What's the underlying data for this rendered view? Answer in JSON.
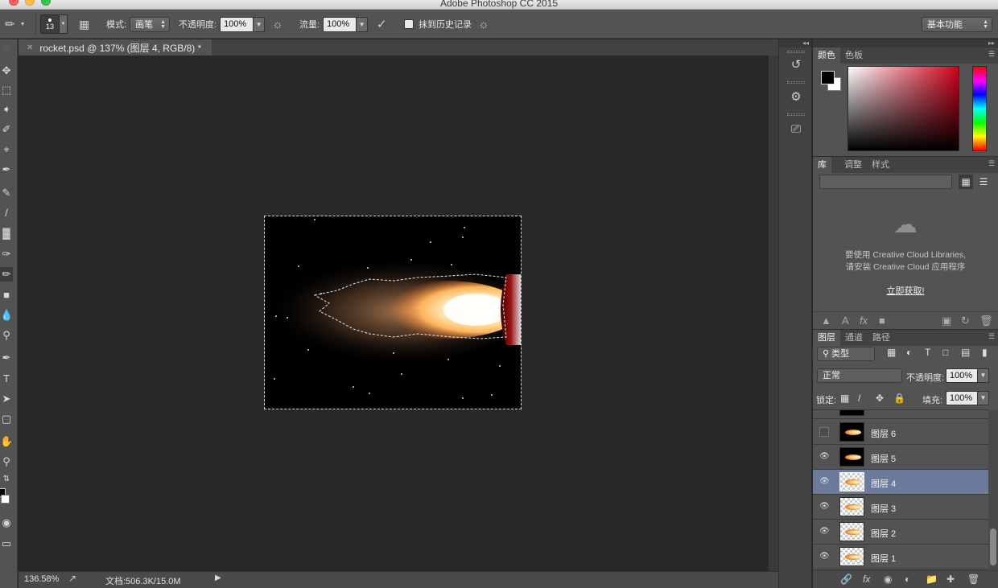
{
  "app": {
    "title": "Adobe Photoshop CC 2015"
  },
  "options": {
    "brush_size": "13",
    "mode_label": "模式:",
    "mode_value": "画笔",
    "opacity_label": "不透明度:",
    "opacity_value": "100%",
    "flow_label": "流量:",
    "flow_value": "100%",
    "history_label": "抹到历史记录",
    "workspace_value": "基本功能"
  },
  "document": {
    "tab_label": "rocket.psd @ 137% (图层 4, RGB/8) *",
    "zoom": "136.58%",
    "doc_info": "文档:506.3K/15.0M"
  },
  "panels": {
    "color_tabs": [
      "颜色",
      "色板"
    ],
    "library_tabs": [
      "库",
      "调整",
      "样式"
    ],
    "library_msg_line1": "要使用 Creative Cloud Libraries,",
    "library_msg_line2": "请安装 Creative Cloud 应用程序",
    "library_link": "立即获取!",
    "layer_tabs": [
      "图层",
      "通道",
      "路径"
    ],
    "filter_kind": "类型",
    "blend_mode": "正常",
    "opacity_label": "不透明度:",
    "opacity_value": "100%",
    "lock_label": "锁定:",
    "fill_label": "填充:",
    "fill_value": "100%"
  },
  "layers": [
    {
      "name": "图层 6",
      "visible": false,
      "selected": false,
      "thumb": "dark"
    },
    {
      "name": "图层 5",
      "visible": true,
      "selected": false,
      "thumb": "dark"
    },
    {
      "name": "图层 4",
      "visible": true,
      "selected": true,
      "thumb": "transparent"
    },
    {
      "name": "图层 3",
      "visible": true,
      "selected": false,
      "thumb": "transparent"
    },
    {
      "name": "图层 2",
      "visible": true,
      "selected": false,
      "thumb": "transparent"
    },
    {
      "name": "图层 1",
      "visible": true,
      "selected": false,
      "thumb": "transparent"
    }
  ],
  "colors": {
    "accent_selected": "#6c7a9c",
    "foreground": "#000000",
    "background": "#ffffff"
  },
  "icons": [
    "eraser-icon",
    "brush-preset-icon",
    "airbrush-icon",
    "tablet-pressure-icon",
    "cloud-library-icon",
    "eye-icon",
    "lock-icon",
    "trash-icon"
  ]
}
